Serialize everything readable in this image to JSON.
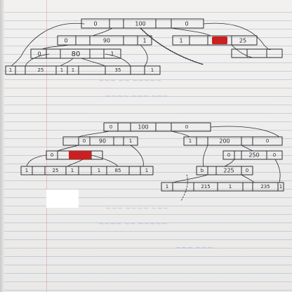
{
  "tree1": {
    "root": {
      "left": "0",
      "key": "100",
      "right": "0"
    },
    "level2": {
      "a": "0",
      "key": "90",
      "b": "1"
    },
    "right_node": {
      "a": "1",
      "b": "25"
    },
    "level3": {
      "key": "80",
      "a": "0",
      "b": "1"
    },
    "leaves": {
      "a": "1",
      "b": "25",
      "c": "1",
      "d": "1",
      "e": "35",
      "f": "1"
    }
  },
  "tree2": {
    "root": {
      "left": "0",
      "key": "100",
      "right": "0"
    },
    "level2": {
      "a": "0",
      "key": "90",
      "b": "1"
    },
    "level3": {
      "a": "0"
    },
    "leaves": {
      "a": "1",
      "b": "25",
      "c": "1",
      "d": "1",
      "e": "85",
      "f": "1"
    },
    "right_node": {
      "a": "1",
      "key": "200",
      "b": "0"
    },
    "right_level": {
      "a": "0",
      "key": "250",
      "b": "0"
    },
    "right_mid": {
      "a": "b",
      "key": "225",
      "b": "0"
    },
    "right_leaves": {
      "a": "1",
      "b": "215",
      "c": "1",
      "d": "235",
      "e": "1"
    }
  },
  "colors": {
    "ink": "#2d2d33",
    "redaction": "#cc1f1f",
    "rule": "#9db3d6"
  }
}
